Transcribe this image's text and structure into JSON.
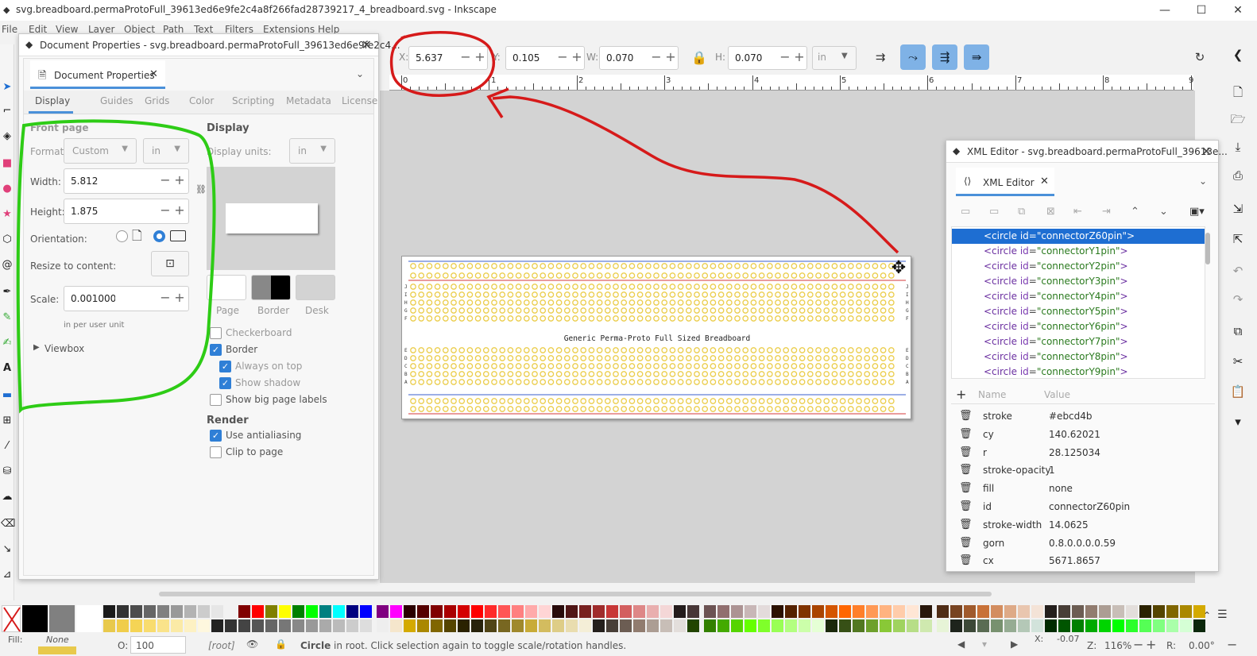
{
  "window": {
    "title": "svg.breadboard.permaProtoFull_39613ed6e9fe2c4a8f266fad28739217_4_breadboard.svg - Inkscape",
    "minimize": "—",
    "maximize": "☐",
    "close": "✕"
  },
  "menu": [
    "File",
    "Edit",
    "View",
    "Layer",
    "Object",
    "Path",
    "Text",
    "Filters",
    "Extensions",
    "Help"
  ],
  "controls": {
    "x_label": "X:",
    "x_value": "5.637",
    "y_label": "Y:",
    "y_value": "0.105",
    "w_label": "W:",
    "w_value": "0.070",
    "h_label": "H:",
    "h_value": "0.070",
    "unit": "in"
  },
  "ruler": {
    "labels": [
      "0",
      "1",
      "2",
      "3",
      "4",
      "5",
      "6",
      "7",
      "8",
      "9"
    ]
  },
  "doc_props": {
    "window_title": "Document Properties - svg.breadboard.permaProtoFull_39613ed6e9fe2c4...",
    "tab_label": "Document Properties",
    "subtabs": [
      "Display",
      "Guides",
      "Grids",
      "Color",
      "Scripting",
      "Metadata",
      "License"
    ],
    "front_page": "Front page",
    "format_label": "Format:",
    "format_value": "Custom",
    "format_unit": "in",
    "width_label": "Width:",
    "width_value": "5.812",
    "height_label": "Height:",
    "height_value": "1.875",
    "orientation_label": "Orientation:",
    "resize_label": "Resize to content:",
    "scale_label": "Scale:",
    "scale_value": "0.001000",
    "scale_unit": "in per user unit",
    "viewbox": "Viewbox",
    "display_header": "Display",
    "display_units_label": "Display units:",
    "display_units_value": "in",
    "page_label": "Page",
    "border_label": "Border",
    "desk_label": "Desk",
    "checkboxes": {
      "checkerboard": "Checkerboard",
      "border": "Border",
      "always_on_top": "Always on top",
      "show_shadow": "Show shadow",
      "big_labels": "Show big page labels"
    },
    "render_header": "Render",
    "use_antialiasing": "Use antialiasing",
    "clip_to_page": "Clip to page"
  },
  "breadboard": {
    "caption": "Generic Perma-Proto Full Sized Breadboard",
    "row_letters_top": [
      "J",
      "I",
      "H",
      "G",
      "F"
    ],
    "row_letters_bottom": [
      "E",
      "D",
      "C",
      "B",
      "A"
    ]
  },
  "xml_editor": {
    "window_title": "XML Editor - svg.breadboard.permaProtoFull_39613e...",
    "tab_label": "XML Editor",
    "nodes": [
      {
        "tag": "<circle",
        "attr": "id",
        "val": "\"connectorZ60pin\"",
        "end": ">"
      },
      {
        "tag": "<circle",
        "attr": "id",
        "val": "\"connectorY1pin\"",
        "end": ">"
      },
      {
        "tag": "<circle",
        "attr": "id",
        "val": "\"connectorY2pin\"",
        "end": ">"
      },
      {
        "tag": "<circle",
        "attr": "id",
        "val": "\"connectorY3pin\"",
        "end": ">"
      },
      {
        "tag": "<circle",
        "attr": "id",
        "val": "\"connectorY4pin\"",
        "end": ">"
      },
      {
        "tag": "<circle",
        "attr": "id",
        "val": "\"connectorY5pin\"",
        "end": ">"
      },
      {
        "tag": "<circle",
        "attr": "id",
        "val": "\"connectorY6pin\"",
        "end": ">"
      },
      {
        "tag": "<circle",
        "attr": "id",
        "val": "\"connectorY7pin\"",
        "end": ">"
      },
      {
        "tag": "<circle",
        "attr": "id",
        "val": "\"connectorY8pin\"",
        "end": ">"
      },
      {
        "tag": "<circle",
        "attr": "id",
        "val": "\"connectorY9pin\"",
        "end": ">"
      }
    ],
    "attr_header_name": "Name",
    "attr_header_value": "Value",
    "attributes": [
      {
        "name": "stroke",
        "value": "#ebcd4b"
      },
      {
        "name": "cy",
        "value": "140.62021"
      },
      {
        "name": "r",
        "value": "28.125034"
      },
      {
        "name": "stroke-opacity",
        "value": "1"
      },
      {
        "name": "fill",
        "value": "none"
      },
      {
        "name": "id",
        "value": "connectorZ60pin"
      },
      {
        "name": "stroke-width",
        "value": "14.0625"
      },
      {
        "name": "gorn",
        "value": "0.8.0.0.0.0.59"
      },
      {
        "name": "cx",
        "value": "5671.8657"
      }
    ]
  },
  "status": {
    "fill_label": "Fill:",
    "fill_value": "None",
    "opacity_label": "O:",
    "opacity_value": "100",
    "layer": "[root]",
    "message_bold": "Circle",
    "message": " in root. Click selection again to toggle scale/rotation handles.",
    "coord_x_label": "X:",
    "coord_x": "-0.07",
    "zoom_label": "Z:",
    "zoom": "116%",
    "rot_label": "R:",
    "rotation": "0.00°"
  },
  "colors": {
    "accent": "#4a90d9",
    "selection": "#1e6ed2",
    "green_annotation": "#2ecc16",
    "red_annotation": "#d61a1a",
    "pin_yellow": "#ebcd4b"
  }
}
